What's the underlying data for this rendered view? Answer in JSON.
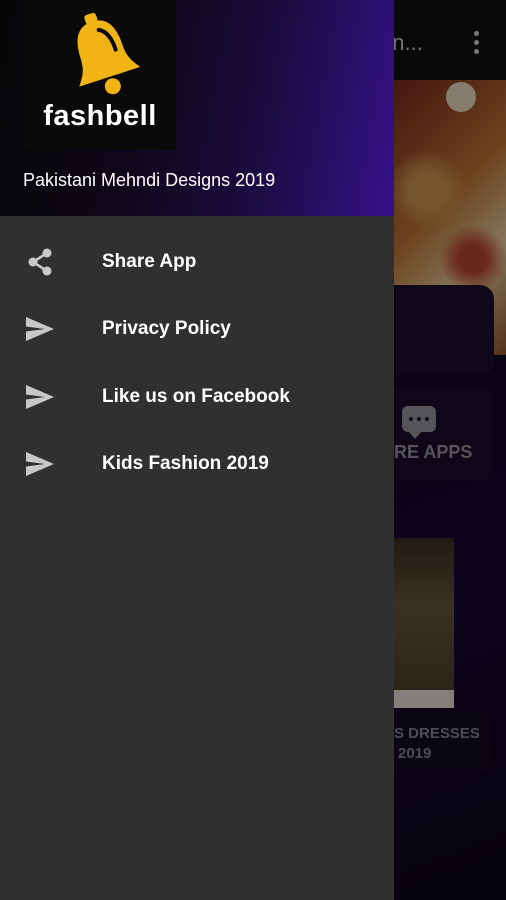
{
  "background": {
    "toolbar_title": "gn...",
    "more_apps_label": "RE APPS",
    "dresses_label_line1": "S DRESSES",
    "dresses_label_line2": "2019"
  },
  "drawer": {
    "logo_text": "fashbell",
    "header_title": "Pakistani Mehndi Designs 2019",
    "items": [
      {
        "label": "Share App",
        "icon": "share-icon"
      },
      {
        "label": "Privacy Policy",
        "icon": "send-icon"
      },
      {
        "label": "Like us on Facebook",
        "icon": "send-icon"
      },
      {
        "label": "Kids Fashion 2019",
        "icon": "send-icon"
      }
    ]
  },
  "colors": {
    "drawer_bg": "#303030",
    "header_accent": "#34128a",
    "bell": "#f2b415",
    "icon": "#c8c8c8",
    "text": "#ffffff"
  }
}
